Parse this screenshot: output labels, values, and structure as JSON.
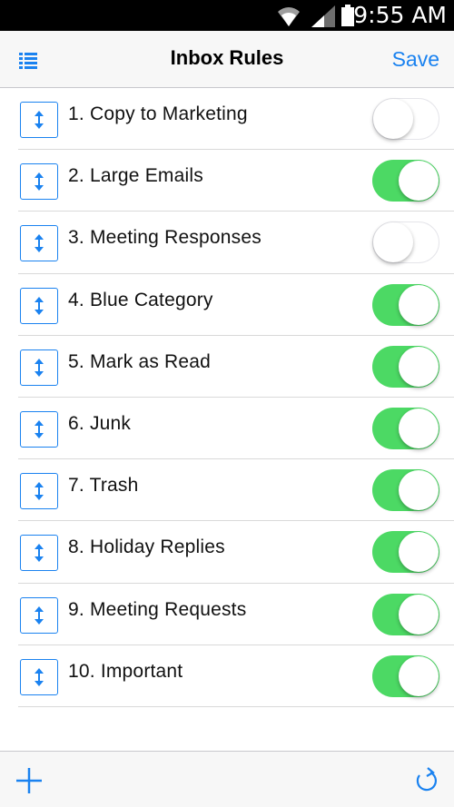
{
  "status_bar": {
    "time": "9:55 AM",
    "icons": [
      "wifi-icon",
      "signal-icon",
      "battery-icon"
    ]
  },
  "nav": {
    "menu_icon": "list-icon",
    "title": "Inbox Rules",
    "save_label": "Save"
  },
  "rules": [
    {
      "label": "1. Copy to Marketing",
      "enabled": false
    },
    {
      "label": "2. Large Emails",
      "enabled": true
    },
    {
      "label": "3. Meeting Responses",
      "enabled": false
    },
    {
      "label": "4. Blue Category",
      "enabled": true
    },
    {
      "label": "5. Mark as Read",
      "enabled": true
    },
    {
      "label": "6. Junk",
      "enabled": true
    },
    {
      "label": "7. Trash",
      "enabled": true
    },
    {
      "label": "8. Holiday Replies",
      "enabled": true
    },
    {
      "label": "9. Meeting Requests",
      "enabled": true
    },
    {
      "label": "10. Important",
      "enabled": true
    }
  ],
  "bottom_bar": {
    "left_icon": "plus-icon",
    "right_icon": "refresh-icon"
  },
  "colors": {
    "accent": "#1a82f0",
    "toggle_on": "#4cd964",
    "background": "#ffffff",
    "bar_background": "#f7f7f7"
  }
}
